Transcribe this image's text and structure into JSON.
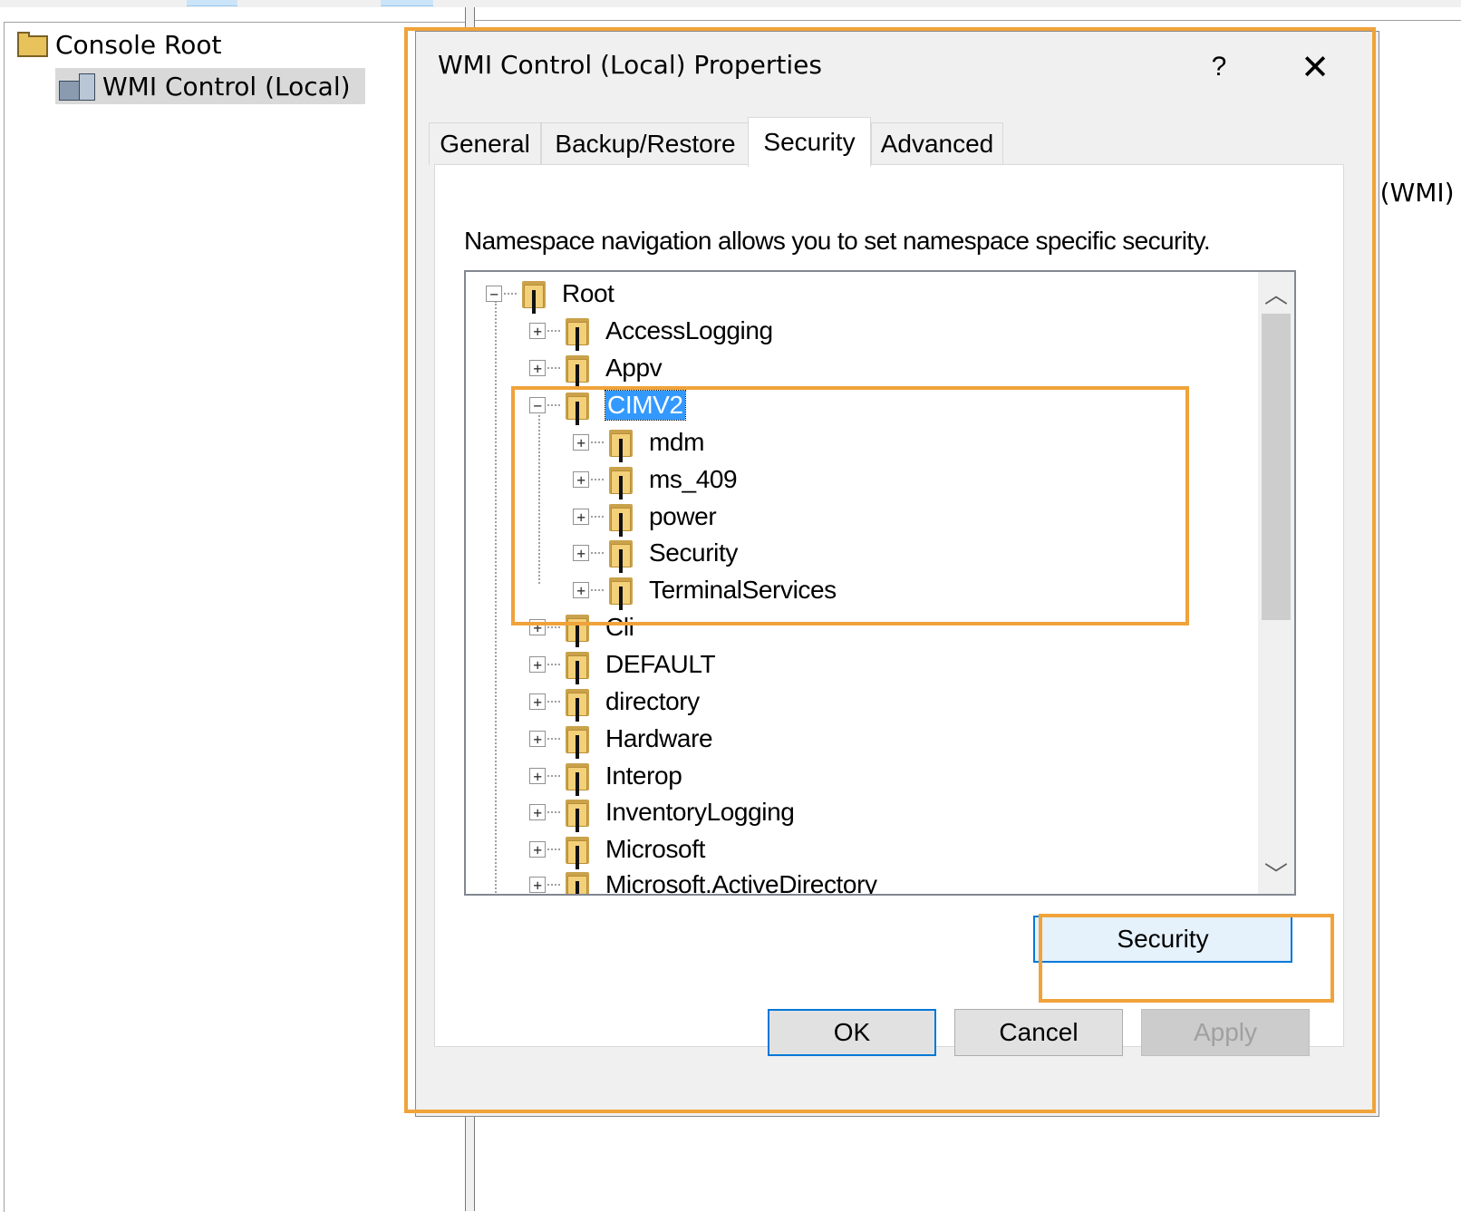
{
  "mmc": {
    "tree": [
      {
        "label": "Console Root",
        "icon": "folder-icon"
      },
      {
        "label": "WMI Control (Local)",
        "icon": "wmi-control-icon",
        "selected": true
      }
    ],
    "right_pane_partial_text": "n (WMI)"
  },
  "dialog": {
    "title": "WMI Control (Local) Properties",
    "help_label": "?",
    "close_label": "✕",
    "tabs": [
      {
        "label": "General"
      },
      {
        "label": "Backup/Restore"
      },
      {
        "label": "Security",
        "active": true
      },
      {
        "label": "Advanced"
      }
    ],
    "description": "Namespace navigation allows you to set namespace specific security.",
    "namespaces": {
      "root": "Root",
      "items": [
        "AccessLogging",
        "Appv",
        "CIMV2",
        "Cli",
        "DEFAULT",
        "directory",
        "Hardware",
        "Interop",
        "InventoryLogging",
        "Microsoft",
        "Microsoft.ActiveDirectory"
      ],
      "cimv2_children": [
        "mdm",
        "ms_409",
        "power",
        "Security",
        "TerminalServices"
      ],
      "selected": "CIMV2"
    },
    "expand_glyph": "+",
    "collapse_glyph": "−",
    "scroll_up": "︿",
    "scroll_down": "﹀",
    "security_button": "Security",
    "ok_button": "OK",
    "cancel_button": "Cancel",
    "apply_button": "Apply"
  },
  "colors": {
    "highlight": "#f0a33a",
    "selection": "#3399ff",
    "focus_border": "#0078d7"
  }
}
